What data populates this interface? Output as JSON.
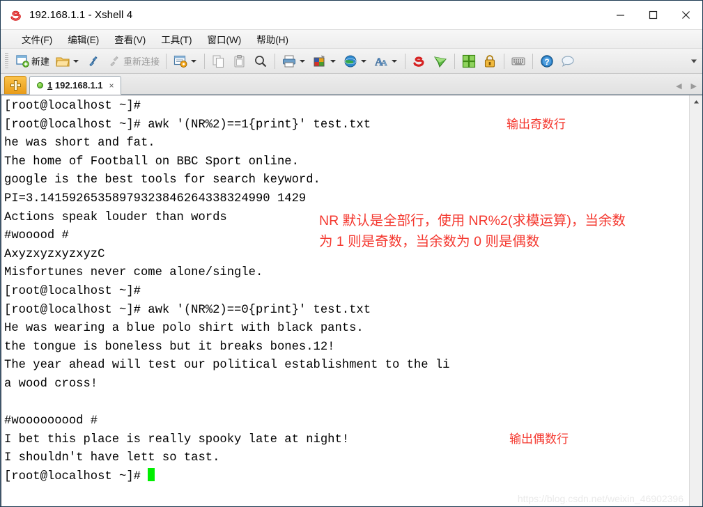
{
  "window": {
    "title": "192.168.1.1 - Xshell 4",
    "app_icon": "xshell-icon",
    "minimize_label": "—",
    "maximize_label": "☐",
    "close_label": "✕"
  },
  "menubar": {
    "items": [
      {
        "label": "文件(F)",
        "name": "menu-file"
      },
      {
        "label": "编辑(E)",
        "name": "menu-edit"
      },
      {
        "label": "查看(V)",
        "name": "menu-view"
      },
      {
        "label": "工具(T)",
        "name": "menu-tools"
      },
      {
        "label": "窗口(W)",
        "name": "menu-window"
      },
      {
        "label": "帮助(H)",
        "name": "menu-help"
      }
    ]
  },
  "toolbar": {
    "new_label": "新建",
    "reconnect_label": "重新连接",
    "icons": [
      "new-session-icon",
      "open-folder-icon",
      "connect-icon",
      "disconnect-icon",
      "session-properties-icon",
      "copy-icon",
      "paste-icon",
      "find-icon",
      "print-icon",
      "color-scheme-icon",
      "globe-icon",
      "font-icon",
      "xshell-icon",
      "xftp-icon",
      "arrange-icon",
      "lock-icon",
      "keyboard-icon",
      "help-icon",
      "chat-icon"
    ]
  },
  "tabbar": {
    "new_tab_label": "+",
    "tab": {
      "number": "1",
      "title": "192.168.1.1",
      "close_label": "×",
      "status": "connected"
    },
    "nav_prev": "◀",
    "nav_next": "▶"
  },
  "terminal": {
    "lines": [
      "[root@localhost ~]#",
      "[root@localhost ~]# awk '(NR%2)==1{print}' test.txt",
      "he was short and fat.",
      "The home of Football on BBC Sport online.",
      "google is the best tools for search keyword.",
      "PI=3.14159265358979323846264338324990 1429",
      "Actions speak louder than words",
      "#wooood #",
      "AxyzxyzxyzxyzC",
      "Misfortunes never come alone/single.",
      "[root@localhost ~]#",
      "[root@localhost ~]# awk '(NR%2)==0{print}' test.txt",
      "He was wearing a blue polo shirt with black pants.",
      "the tongue is boneless but it breaks bones.12!",
      "The year ahead will test our political establishment to the li",
      "a wood cross!",
      "",
      "#wooooooood #",
      "I bet this place is really spooky late at night!",
      "I shouldn't have lett so tast.",
      "[root@localhost ~]# "
    ],
    "cursor": "block-cursor"
  },
  "annotations": {
    "odd_rows": "输出奇数行",
    "even_rows": "输出偶数行",
    "explain_line1": "NR 默认是全部行，使用 NR%2(求模运算)，当余数",
    "explain_line2": "为 1 则是奇数，当余数为 0 则是偶数"
  },
  "watermark": {
    "text": "https://blog.csdn.net/weixin_46902396"
  },
  "colors": {
    "annotation_red": "#f4372e",
    "cursor_green": "#00ef00",
    "terminal_fg": "#000000",
    "terminal_bg": "#ffffff",
    "tab_accent": "#e89b18"
  }
}
